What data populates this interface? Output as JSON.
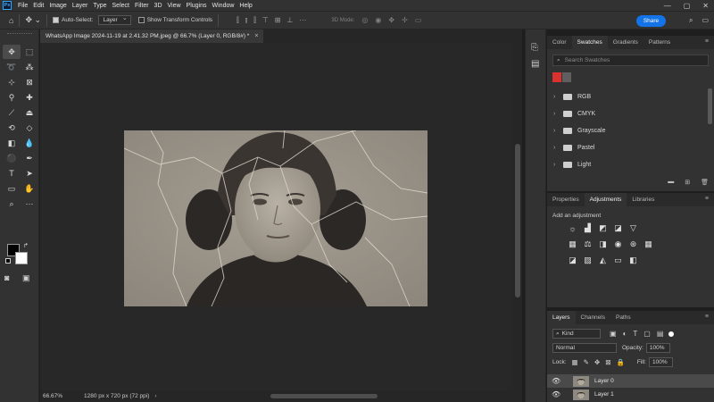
{
  "menubar": {
    "logo": "Ps",
    "items": [
      "File",
      "Edit",
      "Image",
      "Layer",
      "Type",
      "Select",
      "Filter",
      "3D",
      "View",
      "Plugins",
      "Window",
      "Help"
    ],
    "window_controls": {
      "minimize": "—",
      "restore": "▢",
      "close": "✕"
    }
  },
  "options_bar": {
    "auto_select_label": "Auto-Select:",
    "auto_select_checked": true,
    "auto_select_value": "Layer",
    "transform_controls_label": "Show Transform Controls",
    "threed_label": "3D Mode:",
    "share_label": "Share"
  },
  "document": {
    "tab_title": "WhatsApp Image 2024-11-19 at 2.41.32 PM.jpeg @ 66.7% (Layer 0, RGB/8#) *",
    "close": "×",
    "zoom": "66.67%",
    "dimensions": "1280 px x 720 px (72 ppi)",
    "status_arrow": "›"
  },
  "swatches_panel": {
    "tabs": [
      "Color",
      "Swatches",
      "Gradients",
      "Patterns"
    ],
    "active_tab": "Swatches",
    "search_placeholder": "Search Swatches",
    "recent_colors": [
      "#d9322f",
      "#5f5f5f"
    ],
    "folders": [
      "RGB",
      "CMYK",
      "Grayscale",
      "Pastel",
      "Light"
    ]
  },
  "adjustments_panel": {
    "tabs": [
      "Properties",
      "Adjustments",
      "Libraries"
    ],
    "active_tab": "Adjustments",
    "title": "Add an adjustment"
  },
  "layers_panel": {
    "tabs": [
      "Layers",
      "Channels",
      "Paths"
    ],
    "active_tab": "Layers",
    "kind_label": "Kind",
    "blend_mode": "Normal",
    "opacity_label": "Opacity:",
    "opacity_value": "100%",
    "lock_label": "Lock:",
    "fill_label": "Fill:",
    "fill_value": "100%",
    "layers": [
      {
        "name": "Layer 0",
        "selected": true,
        "visible": true
      },
      {
        "name": "Layer 1",
        "selected": false,
        "visible": true
      }
    ]
  },
  "colors": {
    "foreground": "#000000",
    "background": "#ffffff",
    "accent": "#1473e6"
  }
}
